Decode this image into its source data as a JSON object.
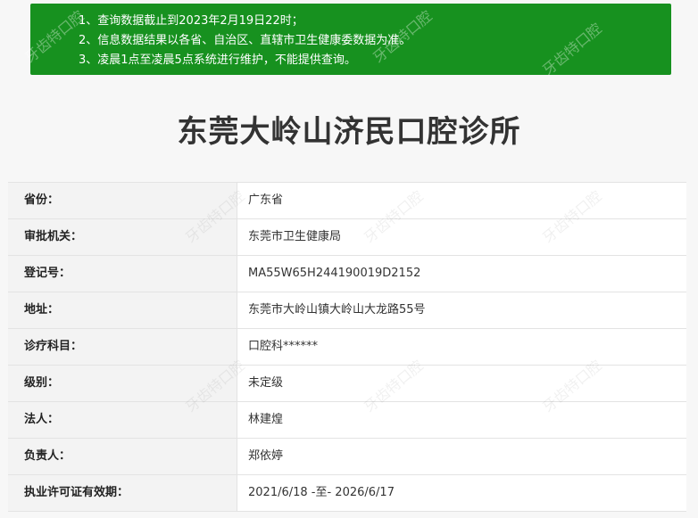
{
  "notice": {
    "lines": [
      "1、查询数据截止到2023年2月19日22时；",
      "2、信息数据结果以各省、自治区、直辖市卫生健康委数据为准。",
      "3、凌晨1点至凌晨5点系统进行维护，不能提供查询。"
    ]
  },
  "page_title": "东莞大岭山济民口腔诊所",
  "info_rows": [
    {
      "label": "省份：",
      "value": "广东省"
    },
    {
      "label": "审批机关：",
      "value": "东莞市卫生健康局"
    },
    {
      "label": "登记号：",
      "value": "MA55W65H244190019D2152"
    },
    {
      "label": "地址：",
      "value": "东莞市大岭山镇大岭山大龙路55号"
    },
    {
      "label": "诊疗科目：",
      "value": "口腔科******"
    },
    {
      "label": "级别：",
      "value": "未定级"
    },
    {
      "label": "法人：",
      "value": "林建煌"
    },
    {
      "label": "负责人：",
      "value": "郑依婷"
    },
    {
      "label": "执业许可证有效期：",
      "value": "2021/6/18 -至- 2026/6/17"
    }
  ],
  "watermark": {
    "text": "牙齿特口腔"
  },
  "colors": {
    "notice_bg": "#17911f",
    "label_bg": "#f3f3f3",
    "title": "#333333"
  }
}
